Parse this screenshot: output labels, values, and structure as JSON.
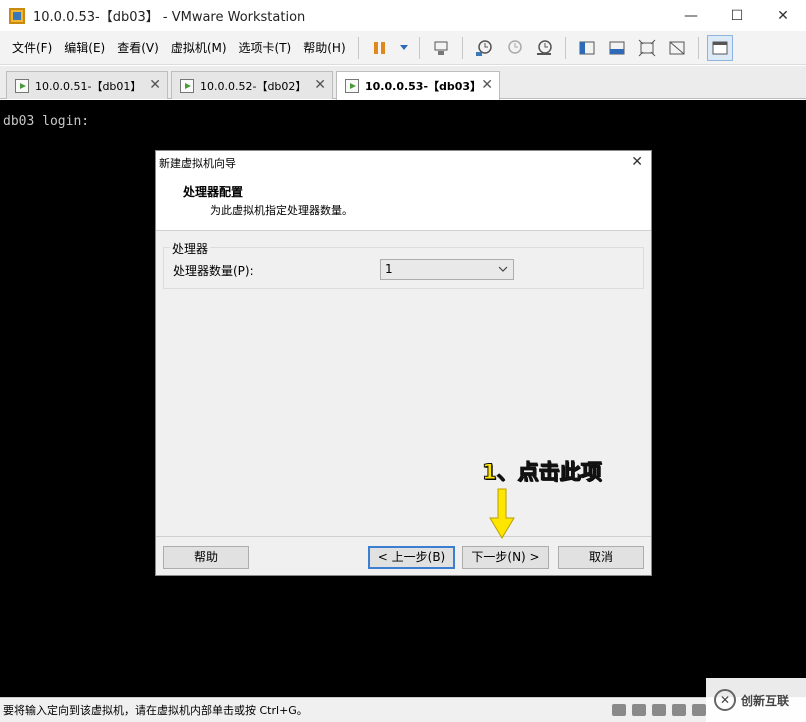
{
  "window": {
    "title": "10.0.0.53-【db03】 - VMware Workstation",
    "minimize": "—",
    "maximize": "☐",
    "close": "✕"
  },
  "menu": [
    "文件(F)",
    "编辑(E)",
    "查看(V)",
    "虚拟机(M)",
    "选项卡(T)",
    "帮助(H)"
  ],
  "tabs": [
    {
      "label": "10.0.0.51-【db01】",
      "close": "✕"
    },
    {
      "label": "10.0.0.52-【db02】",
      "close": "✕"
    },
    {
      "label": "10.0.0.53-【db03】",
      "close": "✕"
    }
  ],
  "console": {
    "text": "db03 login:"
  },
  "dialog": {
    "title": "新建虚拟机向导",
    "close": "✕",
    "heading": "处理器配置",
    "subtitle": "为此虚拟机指定处理器数量。",
    "group_legend": "处理器",
    "processor_label": "处理器数量(P):",
    "processor_value": "1",
    "buttons": {
      "help": "帮助",
      "back": "< 上一步(B)",
      "next": "下一步(N) >",
      "cancel": "取消"
    }
  },
  "annotation": {
    "text": "1、点击此项",
    "color": "#ffe600"
  },
  "status": {
    "text": "要将输入定向到该虚拟机，请在虚拟机内部单击或按 Ctrl+G。"
  },
  "watermark": {
    "logo": "✕",
    "text": "创新互联"
  }
}
